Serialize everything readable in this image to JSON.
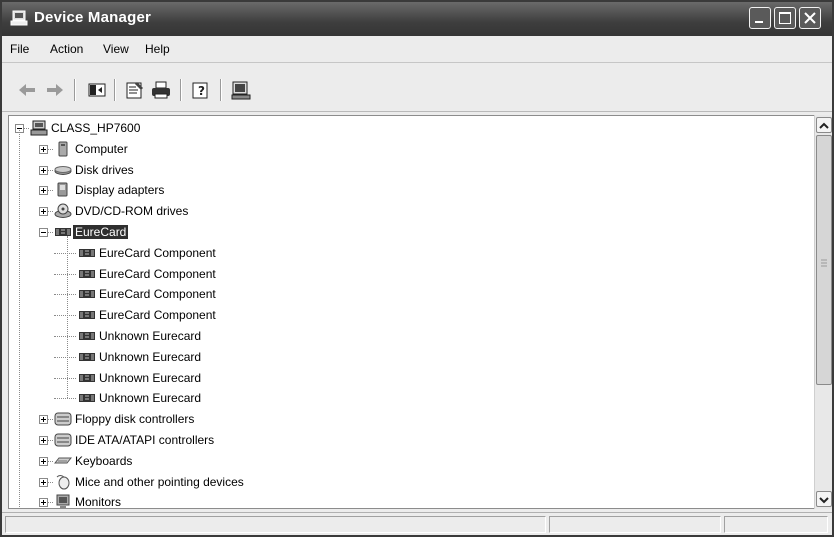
{
  "window": {
    "title": "Device Manager"
  },
  "menu": [
    "File",
    "Action",
    "View",
    "Help"
  ],
  "tree": {
    "root": "CLASS_HP7600",
    "items": [
      {
        "label": "Computer",
        "icon": "computer-icon"
      },
      {
        "label": "Disk drives",
        "icon": "disk-drive-icon"
      },
      {
        "label": "Display adapters",
        "icon": "display-adapter-icon"
      },
      {
        "label": "DVD/CD-ROM drives",
        "icon": "cd-drive-icon"
      },
      {
        "label": "EureCard",
        "icon": "card-icon",
        "expanded": true,
        "selected": true,
        "children": [
          "EureCard Component",
          "EureCard Component",
          "EureCard Component",
          "EureCard Component",
          "Unknown Eurecard",
          "Unknown Eurecard",
          "Unknown Eurecard",
          "Unknown Eurecard"
        ]
      },
      {
        "label": "Floppy disk controllers",
        "icon": "floppy-controller-icon"
      },
      {
        "label": "IDE ATA/ATAPI controllers",
        "icon": "ide-controller-icon"
      },
      {
        "label": "Keyboards",
        "icon": "keyboard-icon"
      },
      {
        "label": "Mice and other pointing devices",
        "icon": "mouse-icon"
      },
      {
        "label": "Monitors",
        "icon": "monitor-icon"
      }
    ]
  }
}
